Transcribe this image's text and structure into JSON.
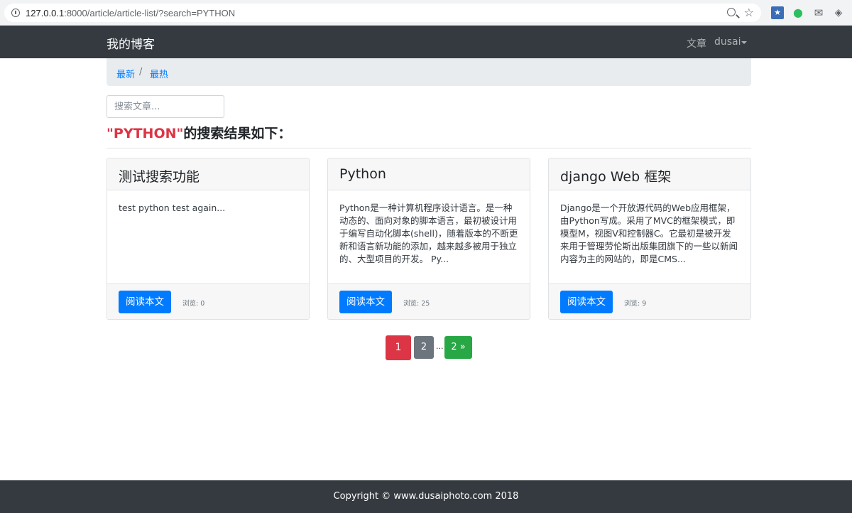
{
  "browser": {
    "url_host": "127.0.0.1",
    "url_rest": ":8000/article/article-list/?search=PYTHON"
  },
  "navbar": {
    "brand": "我的博客",
    "articles_link": "文章",
    "user_menu": "dusai"
  },
  "breadcrumb": {
    "latest": "最新",
    "separator": "/",
    "hot": "最热"
  },
  "search": {
    "placeholder": "搜索文章...",
    "keyword": "\"PYTHON\"",
    "result_suffix": "的搜索结果如下："
  },
  "articles": [
    {
      "title": "测试搜索功能",
      "body": "test python test again...",
      "button": "阅读本文",
      "views": "浏览: 0"
    },
    {
      "title": "Python",
      "body": "Python是一种计算机程序设计语言。是一种动态的、面向对象的脚本语言，最初被设计用于编写自动化脚本(shell)，随着版本的不断更新和语言新功能的添加，越来越多被用于独立的、大型项目的开发。 Py...",
      "button": "阅读本文",
      "views": "浏览: 25"
    },
    {
      "title": "django Web 框架",
      "body": "Django是一个开放源代码的Web应用框架，由Python写成。采用了MVC的框架模式，即模型M，视图V和控制器C。它最初是被开发来用于管理劳伦斯出版集团旗下的一些以新闻内容为主的网站的，即是CMS...",
      "button": "阅读本文",
      "views": "浏览: 9"
    }
  ],
  "pagination": {
    "current": "1",
    "page_two": "2",
    "ellipsis": "...",
    "next": "2 »"
  },
  "footer": {
    "copyright": "Copyright © www.dusaiphoto.com 2018"
  },
  "colors": {
    "navbar": "#343a40",
    "link": "#007bff",
    "danger": "#dc3545",
    "secondary": "#6c757d",
    "success": "#28a745"
  }
}
